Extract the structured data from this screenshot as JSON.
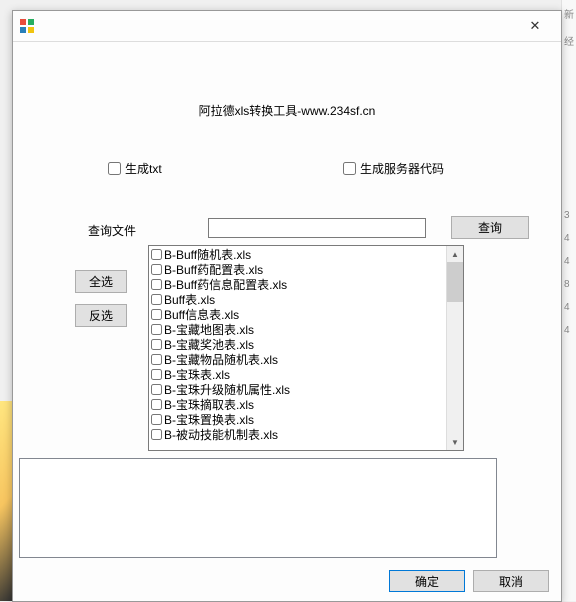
{
  "title": "阿拉德xls转换工具-www.234sf.cn",
  "checkboxes": {
    "gen_txt": "生成txt",
    "gen_server": "生成服务器代码"
  },
  "query": {
    "label": "查询文件",
    "button": "查询",
    "value": ""
  },
  "buttons": {
    "select_all": "全选",
    "invert": "反选",
    "ok": "确定",
    "cancel": "取消"
  },
  "list_items": [
    "B-Buff随机表.xls",
    "B-Buff药配置表.xls",
    "B-Buff药信息配置表.xls",
    "Buff表.xls",
    "Buff信息表.xls",
    "B-宝藏地图表.xls",
    "B-宝藏奖池表.xls",
    "B-宝藏物品随机表.xls",
    "B-宝珠表.xls",
    "B-宝珠升级随机属性.xls",
    "B-宝珠摘取表.xls",
    "B-宝珠置换表.xls",
    "B-被动技能机制表.xls"
  ],
  "bg_numbers": [
    "新",
    "经",
    "3",
    "4",
    "4",
    "8",
    "4",
    "4"
  ]
}
